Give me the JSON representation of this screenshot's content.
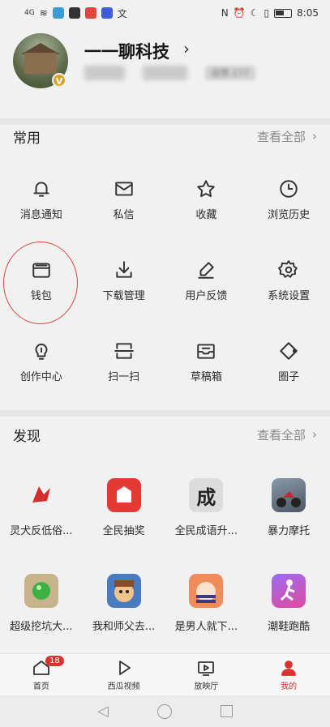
{
  "status_bar": {
    "signal_text": "4G",
    "time": "8:05",
    "right_icons": [
      "nfc-icon",
      "alarm-icon",
      "moon-icon",
      "vibrate-icon",
      "battery-icon"
    ]
  },
  "profile": {
    "username": "一一聊科技",
    "chevron": "›",
    "badge": "V",
    "blurred_stat_visible": "获赞 277"
  },
  "common": {
    "title": "常用",
    "view_all": "查看全部",
    "items": [
      {
        "label": "消息通知",
        "icon": "bell-icon"
      },
      {
        "label": "私信",
        "icon": "mail-icon"
      },
      {
        "label": "收藏",
        "icon": "star-icon"
      },
      {
        "label": "浏览历史",
        "icon": "clock-icon"
      },
      {
        "label": "钱包",
        "icon": "wallet-icon"
      },
      {
        "label": "下载管理",
        "icon": "download-icon"
      },
      {
        "label": "用户反馈",
        "icon": "edit-icon"
      },
      {
        "label": "系统设置",
        "icon": "gear-icon"
      },
      {
        "label": "创作中心",
        "icon": "bulb-icon"
      },
      {
        "label": "扫一扫",
        "icon": "scan-icon"
      },
      {
        "label": "草稿箱",
        "icon": "inbox-icon"
      },
      {
        "label": "圈子",
        "icon": "circle-icon"
      }
    ]
  },
  "discover": {
    "title": "发现",
    "view_all": "查看全部",
    "apps": [
      {
        "label": "灵犬反低俗...",
        "icon": "dog-logo-icon",
        "color": "#d32f2f"
      },
      {
        "label": "全民抽奖",
        "icon": "gift-box-icon",
        "color": "#e53935"
      },
      {
        "label": "全民成语升...",
        "icon": "idiom-icon",
        "color": "#dcdcdc"
      },
      {
        "label": "暴力摩托",
        "icon": "motorbike-icon",
        "color": "#5a6b7c"
      },
      {
        "label": "超级挖坑大...",
        "icon": "green-ball-icon",
        "color": "#c8b48c"
      },
      {
        "label": "我和师父去...",
        "icon": "cartoon-face-icon",
        "color": "#4a7bbf"
      },
      {
        "label": "是男人就下...",
        "icon": "stripes-face-icon",
        "color": "#f08c5a"
      },
      {
        "label": "潮鞋跑酷",
        "icon": "runner-icon",
        "color": "#7b4bd6"
      }
    ]
  },
  "tabbar": {
    "items": [
      {
        "label": "首页",
        "badge": "18",
        "icon": "home-icon"
      },
      {
        "label": "西瓜视频",
        "icon": "play-icon"
      },
      {
        "label": "放映厅",
        "icon": "tv-icon"
      },
      {
        "label": "我的",
        "icon": "person-icon"
      }
    ]
  },
  "colors": {
    "accent": "#d8332e",
    "background": "#f1f1f1"
  }
}
